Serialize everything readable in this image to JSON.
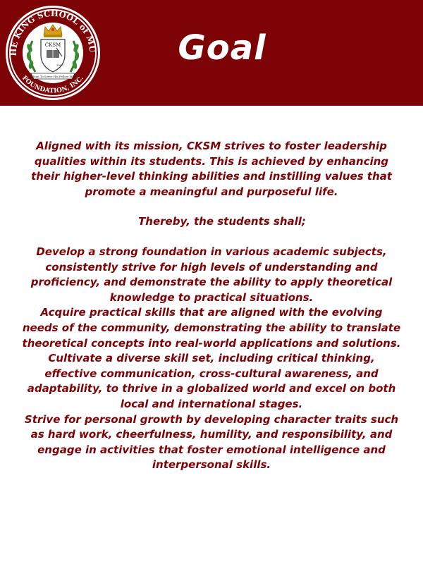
{
  "header": {
    "title": "Goal",
    "logo": {
      "ring_text": "CHRIST THE KING SCHOOL of MUNTINLUPA",
      "bottom_text": "FOUNDATION, INC.",
      "shield_text": "CKSM",
      "motto": "A Man To Serve His Fellow Men",
      "year": "2007"
    }
  },
  "content": {
    "intro": "Aligned with its mission, CKSM strives to foster leadership qualities within its students. This is achieved by enhancing their higher-level thinking abilities and instilling values that promote a meaningful and purposeful life.",
    "lead": "Thereby, the students shall;",
    "goals": [
      "Develop a strong foundation in various academic subjects, consistently strive for high levels of understanding and proficiency, and demonstrate the ability to apply theoretical knowledge to practical situations.",
      "Acquire practical skills that are aligned with the evolving needs of the community, demonstrating the ability to translate theoretical concepts into real-world applications and solutions.",
      "Cultivate a diverse skill set, including critical thinking, effective communication, cross-cultural awareness, and adaptability, to thrive in a globalized world and excel on both local and international stages.",
      "Strive for personal growth by developing character traits such as hard work, cheerfulness, humility, and responsibility, and engage in activities that foster emotional intelligence and interpersonal skills."
    ]
  },
  "colors": {
    "brand_maroon": "#7e0306",
    "gold": "#d4a017",
    "white": "#ffffff"
  }
}
